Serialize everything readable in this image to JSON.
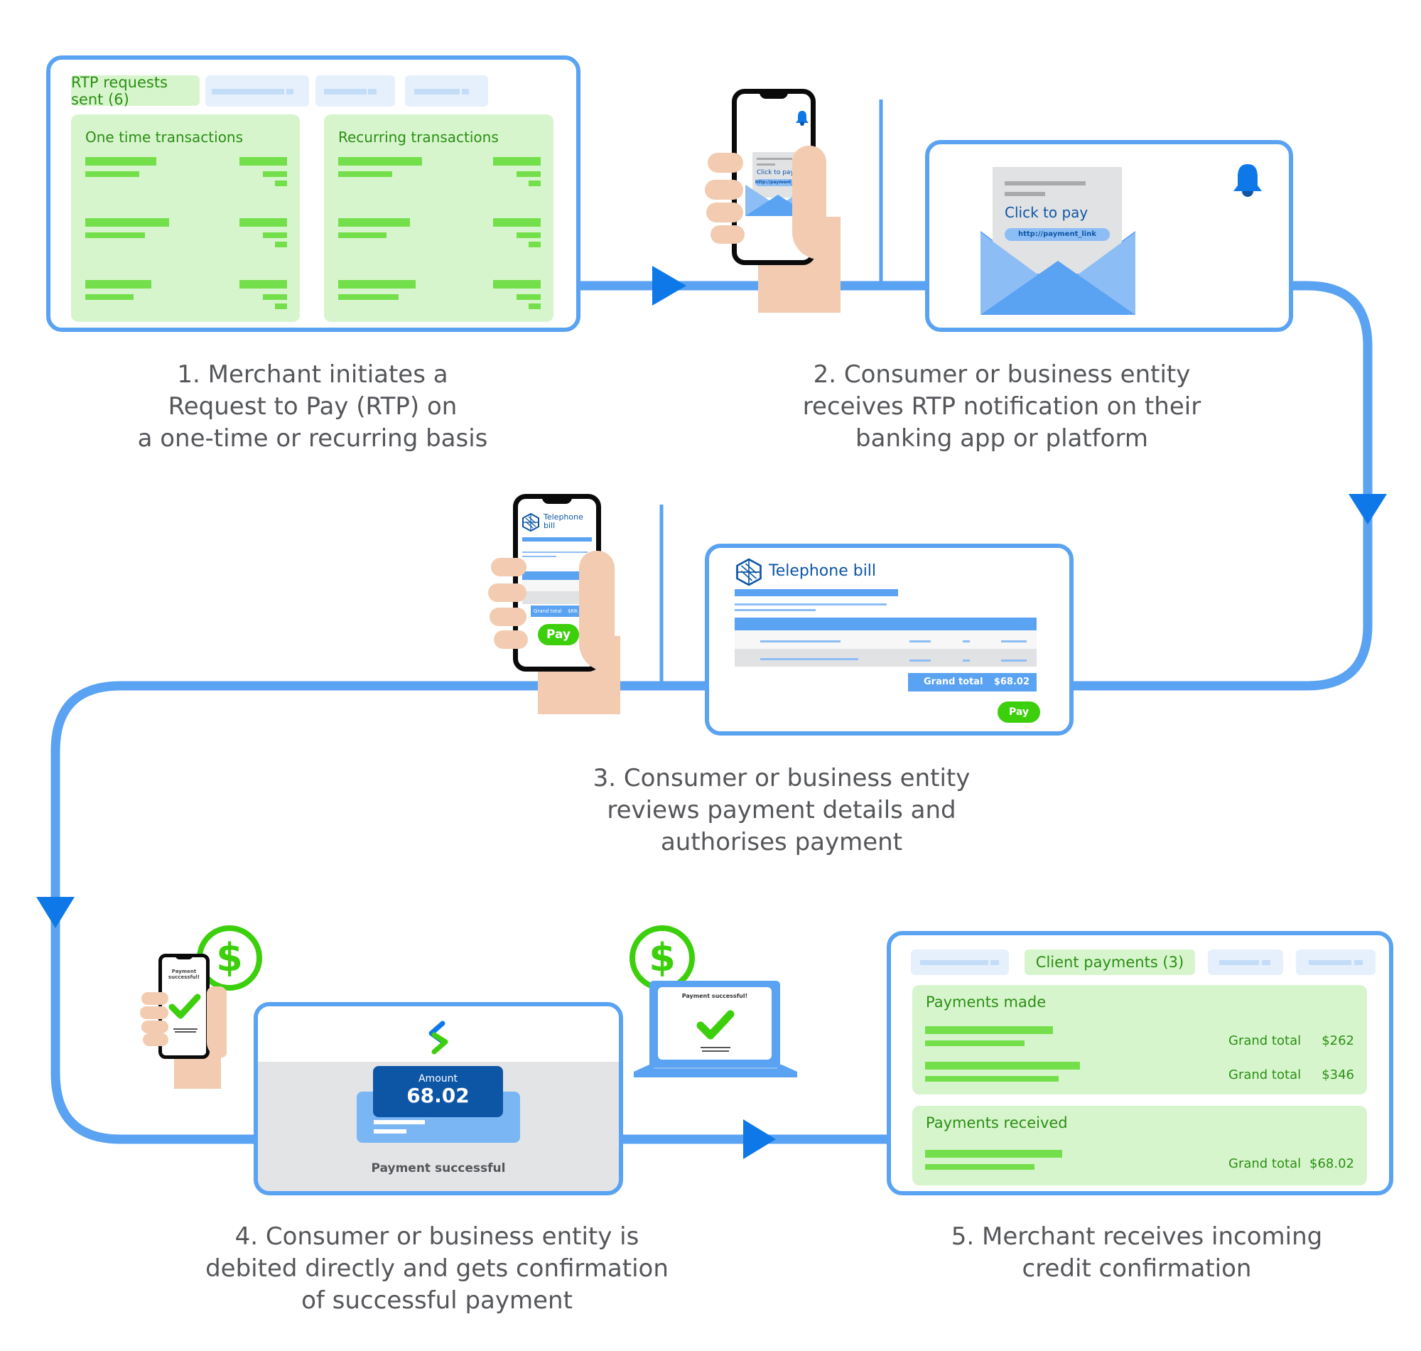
{
  "colors": {
    "flow_line": "#5aa2f2",
    "arrow": "#0f78e8",
    "panel_green": "#d7f5cc",
    "bar_green": "#73df4b",
    "text_green": "#2a8f14",
    "pay_green": "#3ccf0b",
    "caption_grey": "#54565a",
    "navy": "#0d56a6",
    "skin": "#f2cbb0"
  },
  "step1": {
    "active_tab": "RTP requests sent (6)",
    "panels": [
      {
        "title": "One time transactions"
      },
      {
        "title": "Recurring transactions"
      }
    ],
    "caption": [
      "1. Merchant initiates a",
      "Request to Pay (RTP) on",
      "a one-time or recurring basis"
    ]
  },
  "step2": {
    "phone": {
      "click_to_pay": "Click to pay",
      "link": "http://payment_link",
      "icon": "bell-icon"
    },
    "card": {
      "click_to_pay": "Click to pay",
      "link": "http://payment_link",
      "icon": "bell-icon"
    },
    "caption": [
      "2. Consumer or business entity",
      "receives RTP notification on their",
      "banking app or platform"
    ]
  },
  "step3": {
    "phone": {
      "title": "Telephone bill",
      "grand_total_label": "Grand total",
      "grand_total_value": "$68.02",
      "pay": "Pay"
    },
    "card": {
      "title": "Telephone bill",
      "grand_total_label": "Grand total",
      "grand_total_value": "$68.02",
      "pay": "Pay"
    },
    "caption": [
      "3. Consumer or business entity",
      "reviews payment details and",
      "authorises payment"
    ]
  },
  "step4": {
    "phone_status": "Payment successful!",
    "amount_label": "Amount",
    "amount_value": "68.02",
    "status": "Payment successful",
    "laptop_status": "Payment successful!",
    "caption": [
      "4. Consumer or business entity is",
      "debited directly and gets confirmation",
      "of successful payment"
    ]
  },
  "step5": {
    "active_tab": "Client payments (3)",
    "payments_made": {
      "title": "Payments made",
      "rows": [
        {
          "label": "Grand total",
          "value": "$262"
        },
        {
          "label": "Grand total",
          "value": "$346"
        }
      ]
    },
    "payments_received": {
      "title": "Payments received",
      "rows": [
        {
          "label": "Grand total",
          "value": "$68.02"
        }
      ]
    },
    "caption": [
      "5. Merchant receives incoming",
      "credit confirmation"
    ]
  }
}
